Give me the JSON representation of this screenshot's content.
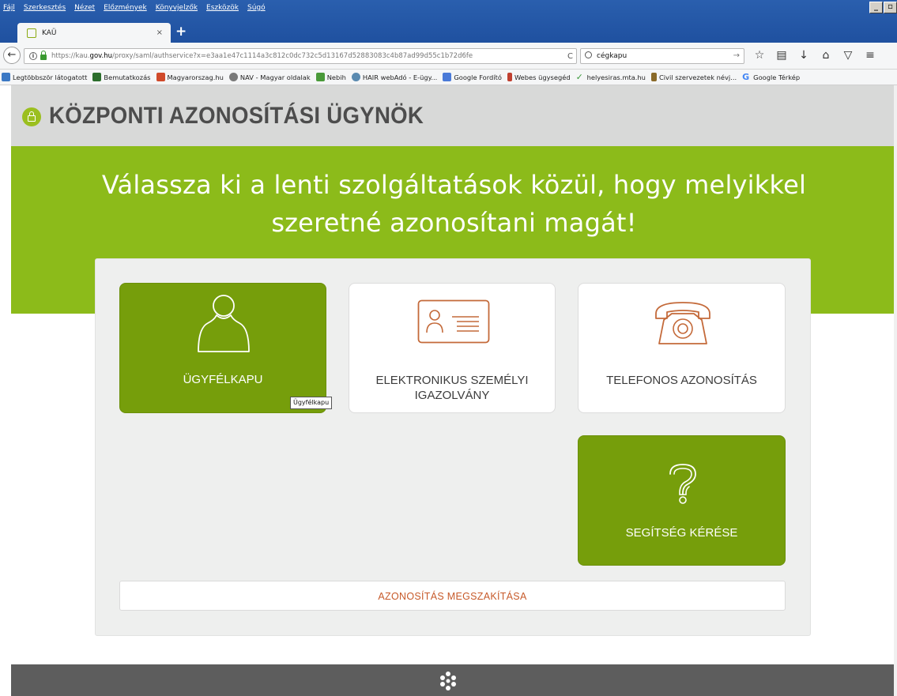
{
  "browser": {
    "menu": [
      "Fájl",
      "Szerkesztés",
      "Nézet",
      "Előzmények",
      "Könyvjelzők",
      "Eszközök",
      "Súgó"
    ],
    "tab_title": "KAÜ",
    "tab_close": "×",
    "new_tab": "+",
    "url_prefix": "https://kau.",
    "url_domain": "gov.hu",
    "url_rest": "/proxy/saml/authservice?x=e3aa1e47c1114a3c812c0dc732c5d13167d52883083c4b87ad99d55c1b72d6fe",
    "search_value": "cégkapu",
    "bookmarks": [
      {
        "label": "Legtöbbször látogatott",
        "color": "#3b78c4"
      },
      {
        "label": "Bemutatkozás",
        "color": "#2c6e2c"
      },
      {
        "label": "Magyarorszag.hu",
        "color": "#d04a2a"
      },
      {
        "label": "NAV - Magyar oldalak",
        "color": "#7a7a7a"
      },
      {
        "label": "Nebih",
        "color": "#4a9a3a"
      },
      {
        "label": "HAIR webAdó - E-ügy...",
        "color": "#5a8ab0"
      },
      {
        "label": "Google Fordító",
        "color": "#4a7ad8"
      },
      {
        "label": "Webes ügysegéd",
        "color": "#c04030"
      },
      {
        "label": "helyesiras.mta.hu",
        "color": "#3a9a3a"
      },
      {
        "label": "Civil szervezetek névj...",
        "color": "#8a6a2a"
      },
      {
        "label": "Google Térkép",
        "color": "#4285f4"
      }
    ]
  },
  "page": {
    "title": "KÖZPONTI AZONOSÍTÁSI ÜGYNÖK",
    "hero_line1": "Válassza ki a lenti szolgáltatások közül, hogy melyikkel",
    "hero_line2": "szeretné azonosítani magát!",
    "tiles": {
      "ugyfelkapu": "ÜGYFÉLKAPU",
      "eszig_line1": "ELEKTRONIKUS SZEMÉLYI",
      "eszig_line2": "IGAZOLVÁNY",
      "telefon": "TELEFONOS AZONOSÍTÁS",
      "help": "SEGÍTSÉG KÉRÉSE"
    },
    "tooltip": "Ügyfélkapu",
    "cancel": "AZONOSÍTÁS MEGSZAKÍTÁSA"
  },
  "colors": {
    "accent_green": "#8cbb1a",
    "tile_green": "#769e0b",
    "icon_orange": "#c46a3a",
    "cancel_text": "#c75a2a"
  }
}
